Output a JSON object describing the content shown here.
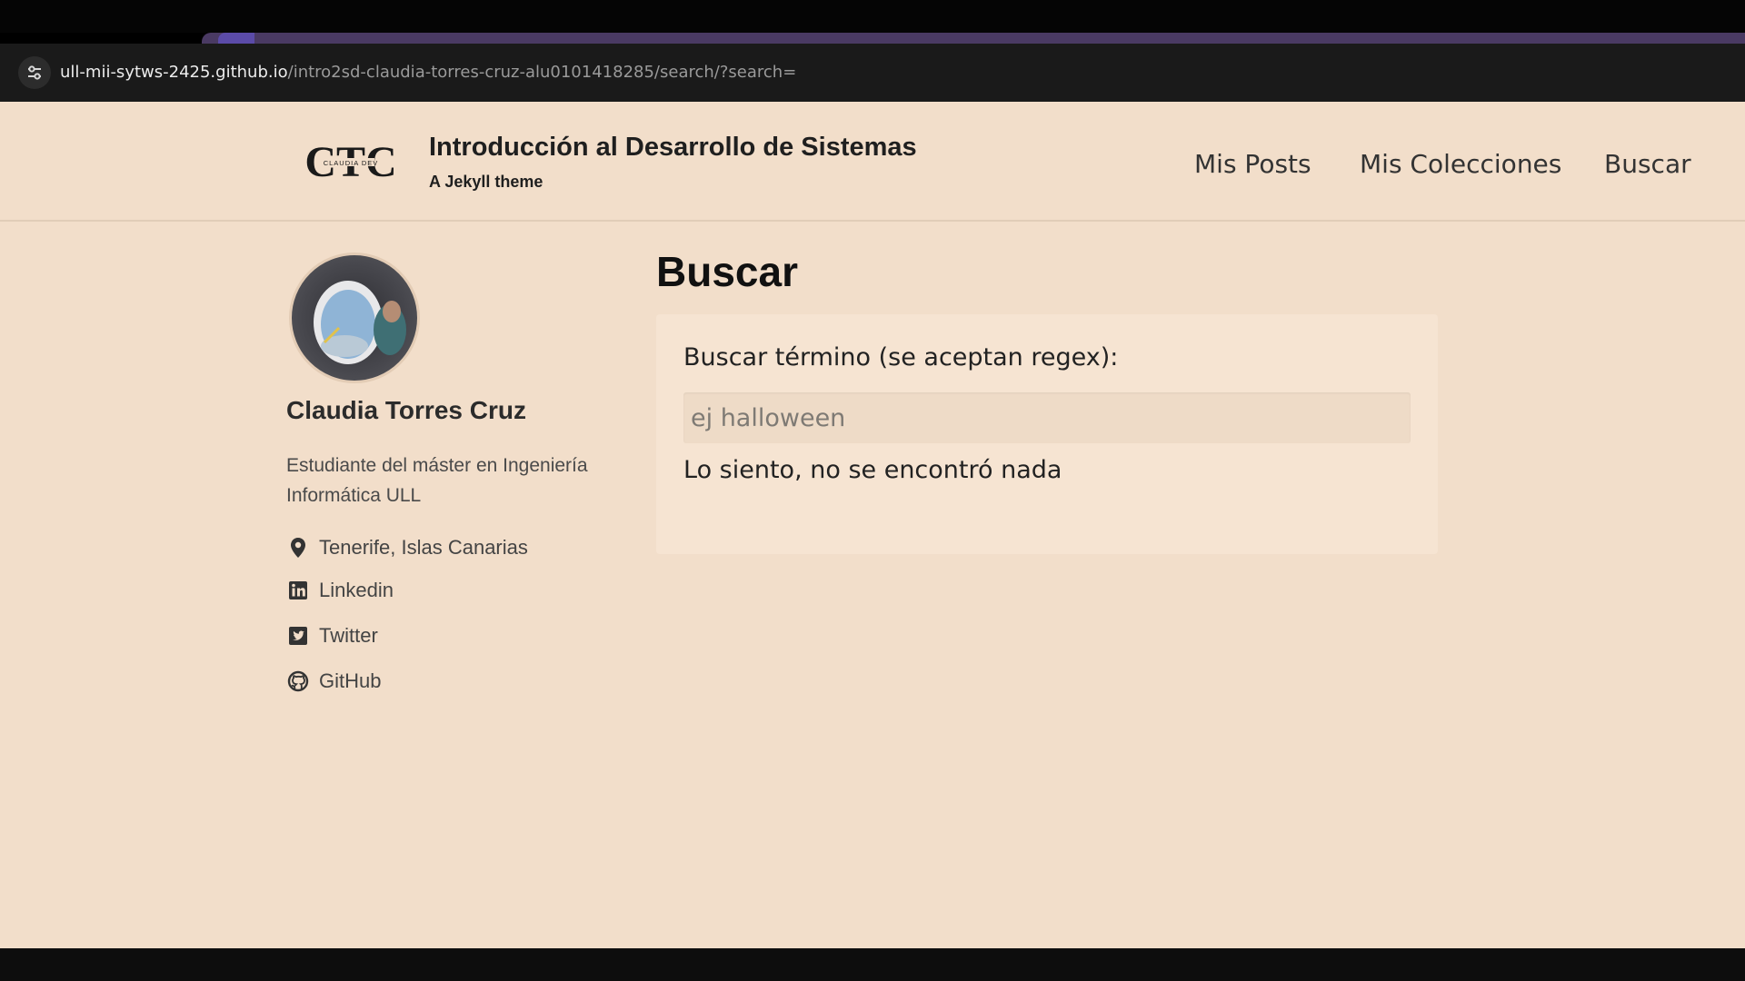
{
  "browser": {
    "url_host": "ull-mii-sytws-2425.github.io",
    "url_path": "/intro2sd-claudia-torres-cruz-alu0101418285/search/?search="
  },
  "site": {
    "logo_text": "CTC",
    "logo_small_text": "CLAUDIA DEV",
    "title": "Introducción al Desarrollo de Sistemas",
    "subtitle": "A Jekyll theme"
  },
  "nav": {
    "items": [
      {
        "label": "Mis Posts"
      },
      {
        "label": "Mis Colecciones"
      },
      {
        "label": "Buscar"
      }
    ]
  },
  "author": {
    "name": "Claudia Torres Cruz",
    "bio": "Estudiante del máster en Ingeniería Informática ULL",
    "links": [
      {
        "icon": "map-marker-icon",
        "label": "Tenerife, Islas Canarias"
      },
      {
        "icon": "linkedin-icon",
        "label": "Linkedin"
      },
      {
        "icon": "twitter-icon",
        "label": "Twitter"
      },
      {
        "icon": "github-icon",
        "label": "GitHub"
      }
    ]
  },
  "main": {
    "title": "Buscar",
    "search": {
      "label": "Buscar término (se aceptan regex):",
      "placeholder": "ej halloween",
      "value": "",
      "no_results": "Lo siento, no se encontró nada"
    }
  },
  "colors": {
    "page_bg": "#f2deca",
    "card_bg": "#f6e4d2",
    "input_bg": "#eedbc7",
    "tab_strip": "#4a3a63"
  }
}
